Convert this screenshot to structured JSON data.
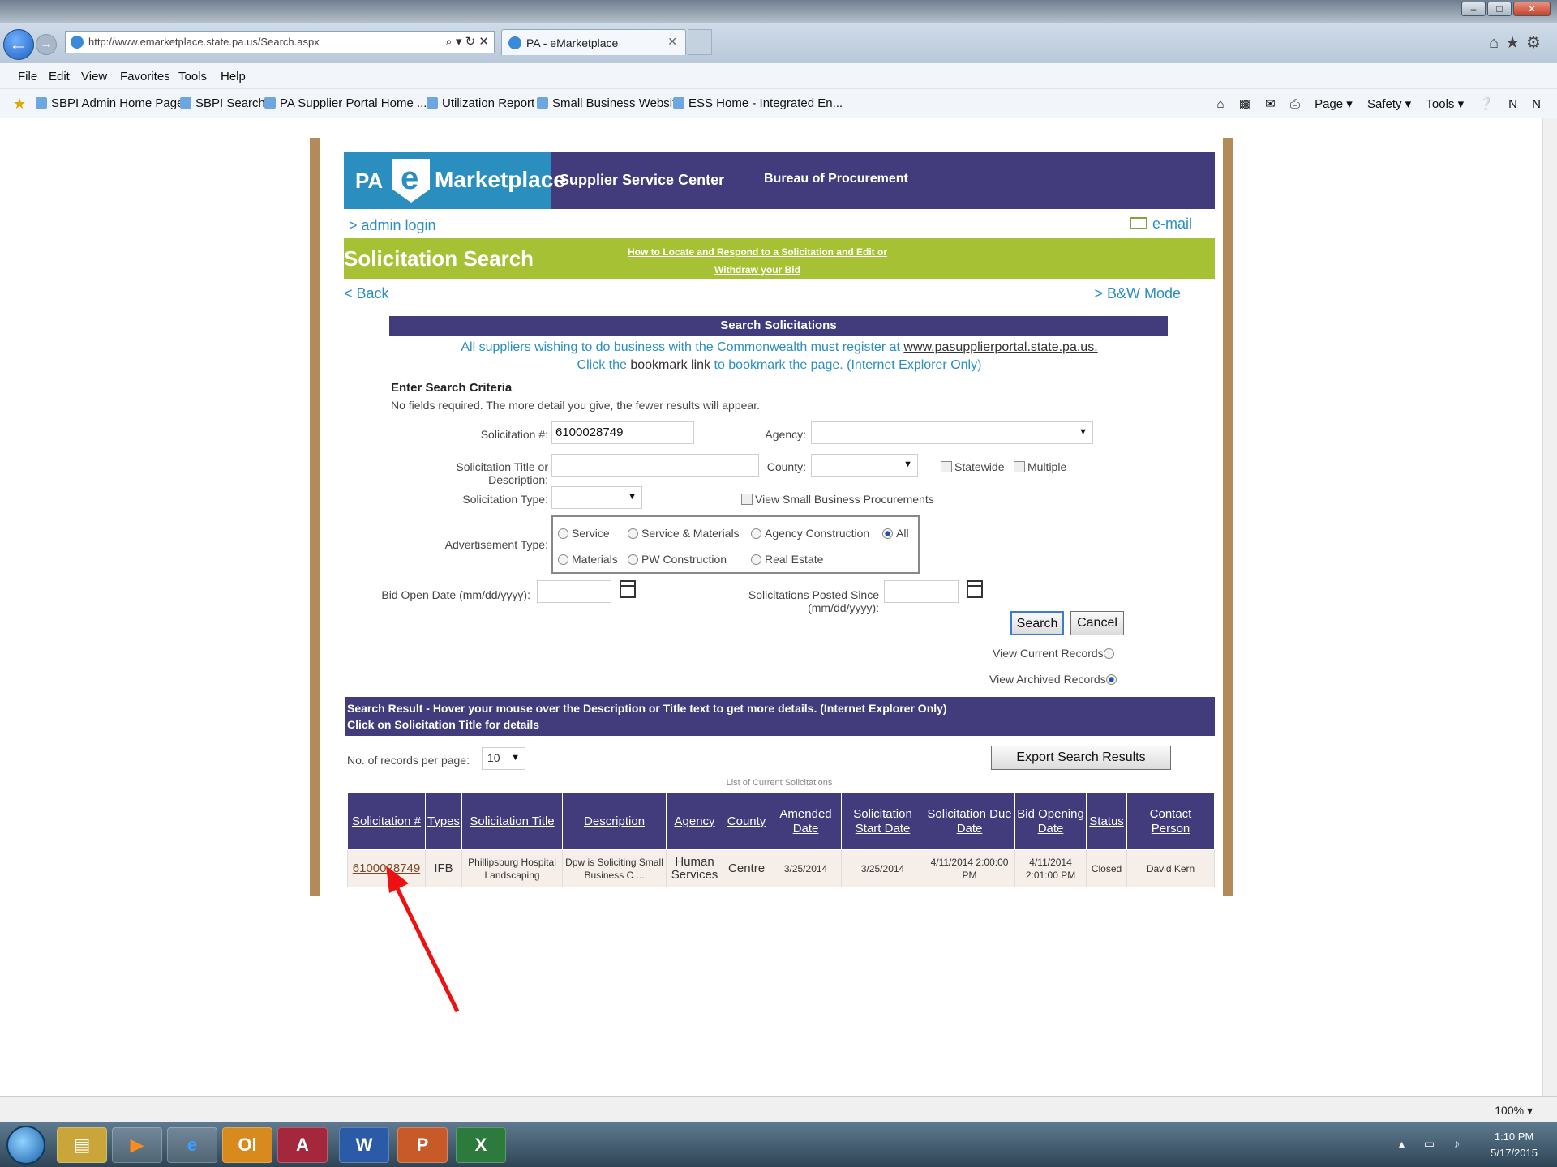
{
  "browser": {
    "url": "http://www.emarketplace.state.pa.us/Search.aspx",
    "address_tools": "⌕ ▾ ↻ ✕",
    "tab_title": "PA - eMarketplace",
    "tab_close": "✕",
    "right_icons": "⌂★⚙",
    "win_controls": [
      "–",
      "□",
      "✕"
    ],
    "menu": [
      "File",
      "Edit",
      "View",
      "Favorites",
      "Tools",
      "Help"
    ],
    "favorites": [
      "SBPI Admin Home Page",
      "SBPI Search",
      "PA Supplier Portal Home ...",
      "Utilization Report",
      "Small Business Website",
      "ESS Home - Integrated En..."
    ],
    "commands": [
      "Page ▾",
      "Safety ▾",
      "Tools ▾"
    ],
    "zoom": " 100%  ▾"
  },
  "header": {
    "logo_pa": "PA",
    "logo_e": "e",
    "logo_marketplace": "Marketplace",
    "supplier_service_center": "Supplier Service Center",
    "bureau": "Bureau of Procurement"
  },
  "links": {
    "admin_login": "> admin login",
    "email": "e-mail",
    "back": "< Back",
    "bw_mode": "> B&W Mode",
    "howto": "How to Locate and Respond to a Solicitation and Edit or Withdraw your Bid"
  },
  "page_title": "Solicitation Search",
  "search_section": {
    "heading": "Search Solicitations",
    "notice1_text": "All suppliers wishing to do business with the Commonwealth must register at ",
    "notice1_link": "www.pasupplierportal.state.pa.us.",
    "notice2_pre": "Click the ",
    "notice2_link": "bookmark link",
    "notice2_post": " to bookmark the page. (Internet Explorer Only)",
    "criteria_title": "Enter Search Criteria",
    "criteria_sub": "No fields required. The more detail you give, the fewer results will appear."
  },
  "form": {
    "solicitation_no_label": "Solicitation #:",
    "solicitation_no_value": "6100028749",
    "agency_label": "Agency:",
    "agency_value": "",
    "title_desc_label": "Solicitation Title or Description:",
    "title_desc_value": "",
    "county_label": "County:",
    "county_value": "",
    "statewide_label": "Statewide",
    "multiple_label": "Multiple",
    "type_label": "Solicitation Type:",
    "type_value": "",
    "small_business_label": "View Small Business Procurements",
    "adv_type_label": "Advertisement Type:",
    "adv_options": [
      "Service",
      "Service & Materials",
      "Agency Construction",
      "All",
      "Materials",
      "PW Construction",
      "Real Estate"
    ],
    "adv_selected": "All",
    "bid_open_label": "Bid Open Date (mm/dd/yyyy):",
    "bid_open_value": "",
    "posted_since_label": "Solicitations Posted Since (mm/dd/yyyy):",
    "posted_since_value": "",
    "search_button": "Search",
    "cancel_button": "Cancel",
    "view_current": "View Current Records",
    "view_archived": "View Archived Records",
    "records_view_selected": "View Archived Records"
  },
  "results": {
    "bar_line1": "Search Result - Hover your mouse over the Description or Title text to get more details. (Internet Explorer Only)",
    "bar_line2": "Click on Solicitation Title for details",
    "records_per_page_label": "No. of records per page:",
    "records_per_page_value": "10",
    "export_button": "Export Search Results",
    "caption": "List of Current Solicitations",
    "columns": [
      "Solicitation #",
      "Types",
      "Solicitation Title",
      "Description",
      "Agency",
      "County",
      "Amended Date",
      "Solicitation Start Date",
      "Solicitation Due Date",
      "Bid Opening Date",
      "Status",
      "Contact Person"
    ],
    "rows": [
      [
        "6100028749",
        "IFB",
        "Phillipsburg Hospital Landscaping",
        "Dpw is Soliciting Small Business C ...",
        "Human Services",
        "Centre",
        "3/25/2014",
        "3/25/2014",
        "4/11/2014 2:00:00 PM",
        "4/11/2014 2:01:00 PM",
        "Closed",
        "David Kern"
      ]
    ]
  },
  "annotation": {
    "arrow_color": "#ee1111"
  },
  "taskbar": {
    "apps": [
      "▤",
      "▶",
      "e",
      "Ol",
      "A",
      "W",
      "P",
      "X"
    ],
    "tray_icons": "▴ ▭ ♪",
    "time": "1:10 PM",
    "date": "5/17/2015"
  }
}
